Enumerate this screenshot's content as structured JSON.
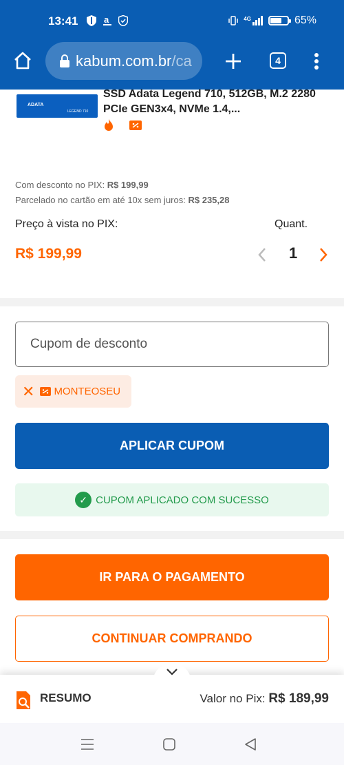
{
  "status_bar": {
    "time": "13:41",
    "signal_label": "4G",
    "battery": "65%",
    "battery_level": 0.65
  },
  "browser": {
    "url_main": "kabum.com.br",
    "url_path": "/ca",
    "tab_count": "4"
  },
  "product": {
    "title": "SSD Adata Legend 710, 512GB, M.2 2280 PCIe GEN3x4, NVMe 1.4,...",
    "image_brand": "ADATA",
    "image_model": "LEGEND 710",
    "pix_discount_label": "Com desconto no PIX:",
    "pix_discount_value": "R$ 199,99",
    "installment_label": "Parcelado no cartão em até 10x sem juros:",
    "installment_value": "R$ 235,28",
    "cash_price_label": "Preço à vista no PIX:",
    "cash_price": "R$ 199,99",
    "quantity_label": "Quant.",
    "quantity": "1"
  },
  "coupon": {
    "placeholder": "Cupom de desconto",
    "applied_code": "MONTEOSEU",
    "apply_button": "APLICAR CUPOM",
    "success_message": "CUPOM APLICADO COM SUCESSO"
  },
  "actions": {
    "payment_button": "IR PARA O PAGAMENTO",
    "continue_button": "CONTINUAR COMPRANDO"
  },
  "summary": {
    "label": "RESUMO",
    "pix_value_label": "Valor no Pix:",
    "pix_value": "R$ 189,99"
  },
  "colors": {
    "brand_blue": "#0a5db3",
    "accent_orange": "#ff6500",
    "success_green": "#239b4c"
  }
}
